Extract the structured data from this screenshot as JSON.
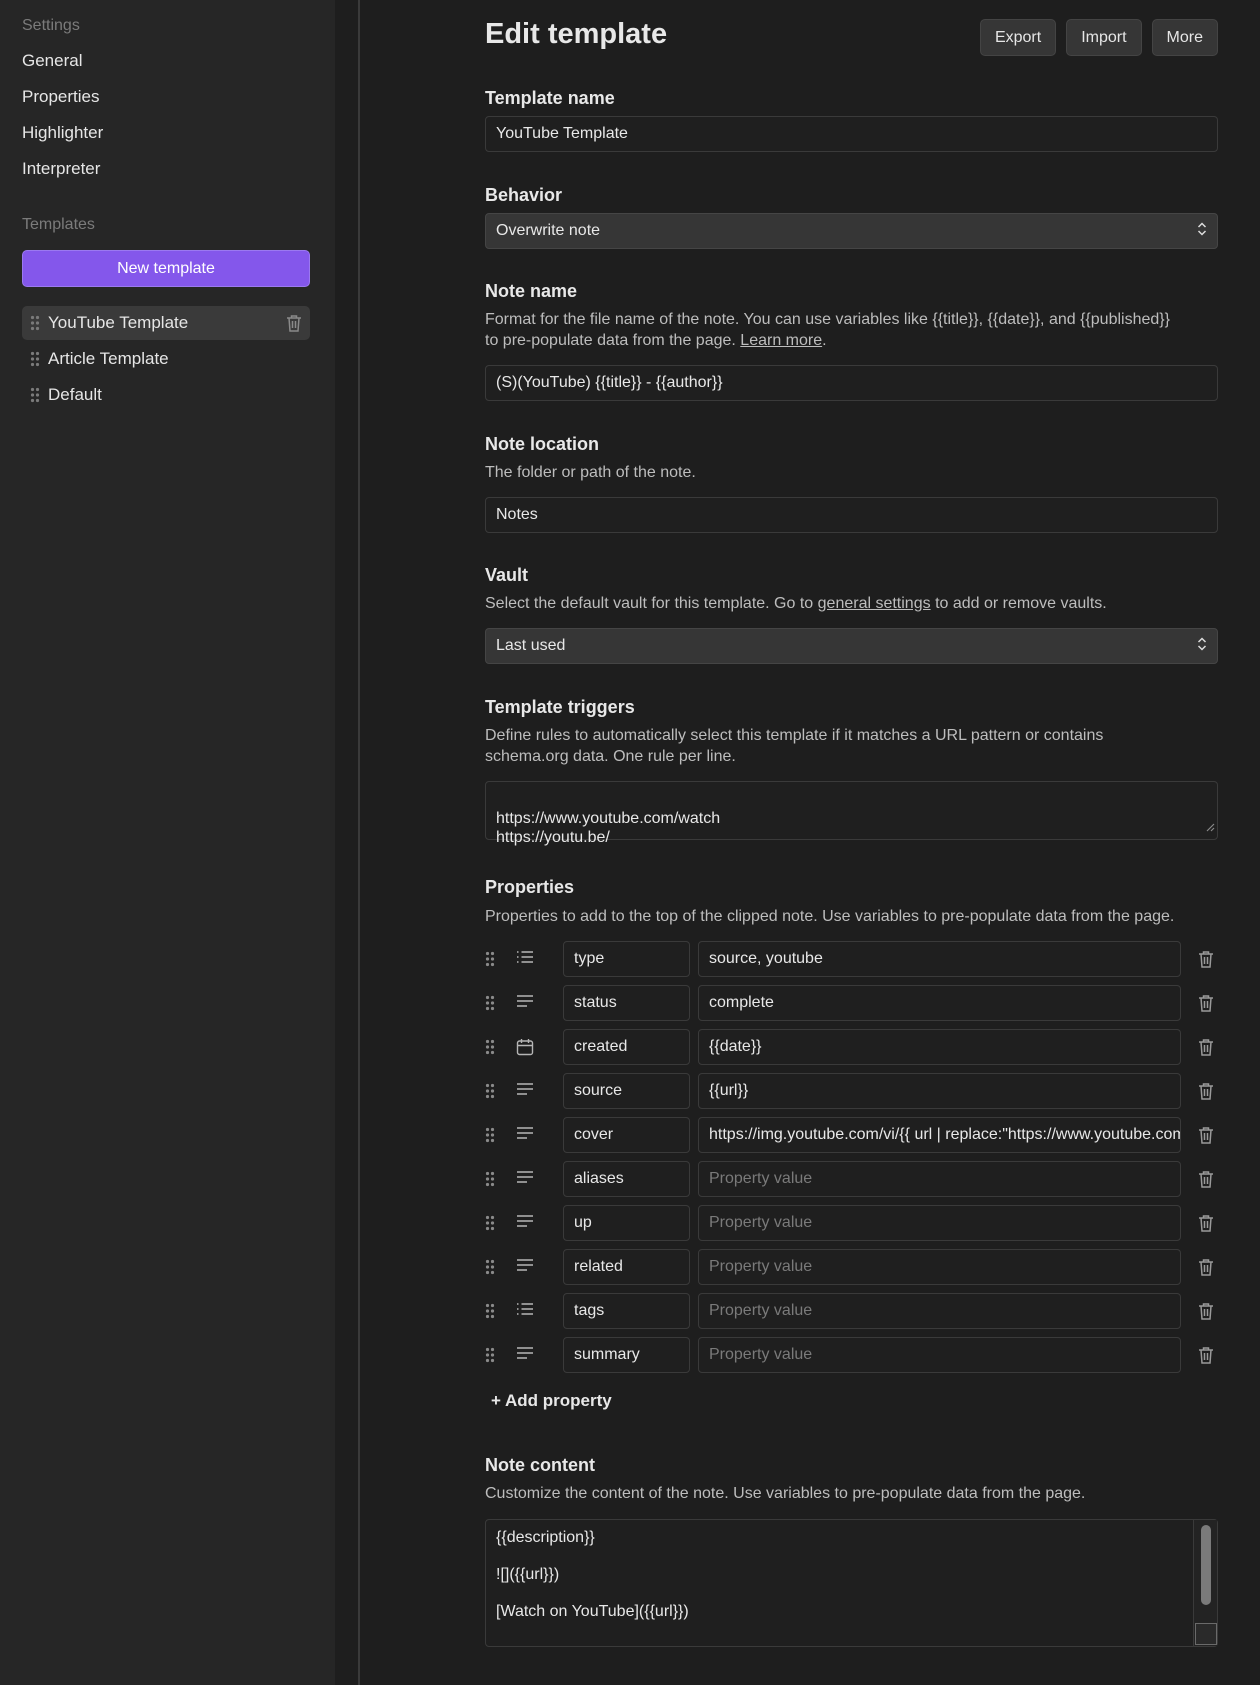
{
  "sidebar": {
    "settings_heading": "Settings",
    "nav": [
      "General",
      "Properties",
      "Highlighter",
      "Interpreter"
    ],
    "templates_heading": "Templates",
    "new_template_label": "New template",
    "templates": [
      "YouTube Template",
      "Article Template",
      "Default"
    ]
  },
  "header": {
    "title": "Edit template",
    "export_label": "Export",
    "import_label": "Import",
    "more_label": "More"
  },
  "template_name": {
    "label": "Template name",
    "value": "YouTube Template"
  },
  "behavior": {
    "label": "Behavior",
    "value": "Overwrite note"
  },
  "note_name": {
    "label": "Note name",
    "desc_line1": "Format for the file name of the note. You can use variables like {{title}}, {{date}}, and {{published}}",
    "desc_line2": "to pre-populate data from the page.",
    "learn_more": "Learn more",
    "period": ".",
    "value": "(S)(YouTube) {{title}} - {{author}}"
  },
  "note_location": {
    "label": "Note location",
    "desc": "The folder or path of the note.",
    "value": "Notes"
  },
  "vault": {
    "label": "Vault",
    "desc_prefix": "Select the default vault for this template. Go to",
    "desc_link": "general settings",
    "desc_suffix": "to add or remove vaults.",
    "value": "Last used"
  },
  "triggers": {
    "label": "Template triggers",
    "desc_line1": "Define rules to automatically select this template if it matches a URL pattern or contains",
    "desc_line2": "schema.org data. One rule per line.",
    "value": "https://www.youtube.com/watch\nhttps://youtu.be/"
  },
  "properties": {
    "label": "Properties",
    "desc": "Properties to add to the top of the clipped note. Use variables to pre-populate data from the page.",
    "placeholder": "Property value",
    "items": [
      {
        "name": "type",
        "value": "source, youtube",
        "icon": "list-icon"
      },
      {
        "name": "status",
        "value": "complete",
        "icon": "text-icon"
      },
      {
        "name": "created",
        "value": "{{date}}",
        "icon": "calendar-icon"
      },
      {
        "name": "source",
        "value": "{{url}}",
        "icon": "text-icon"
      },
      {
        "name": "cover",
        "value": "https://img.youtube.com/vi/{{ url | replace:\"https://www.youtube.com/watch?v=\":\"\" }}/maxresdefault.jpg",
        "icon": "text-icon"
      },
      {
        "name": "aliases",
        "value": "",
        "icon": "text-icon"
      },
      {
        "name": "up",
        "value": "",
        "icon": "text-icon"
      },
      {
        "name": "related",
        "value": "",
        "icon": "text-icon"
      },
      {
        "name": "tags",
        "value": "",
        "icon": "list-icon"
      },
      {
        "name": "summary",
        "value": "",
        "icon": "text-icon"
      }
    ],
    "add_label": "+ Add property"
  },
  "note_content": {
    "label": "Note content",
    "desc": "Customize the content of the note. Use variables to pre-populate data from the page.",
    "line1": "{{description}}",
    "line2": "![]({{url}})",
    "line3": "[Watch on YouTube]({{url}})"
  }
}
